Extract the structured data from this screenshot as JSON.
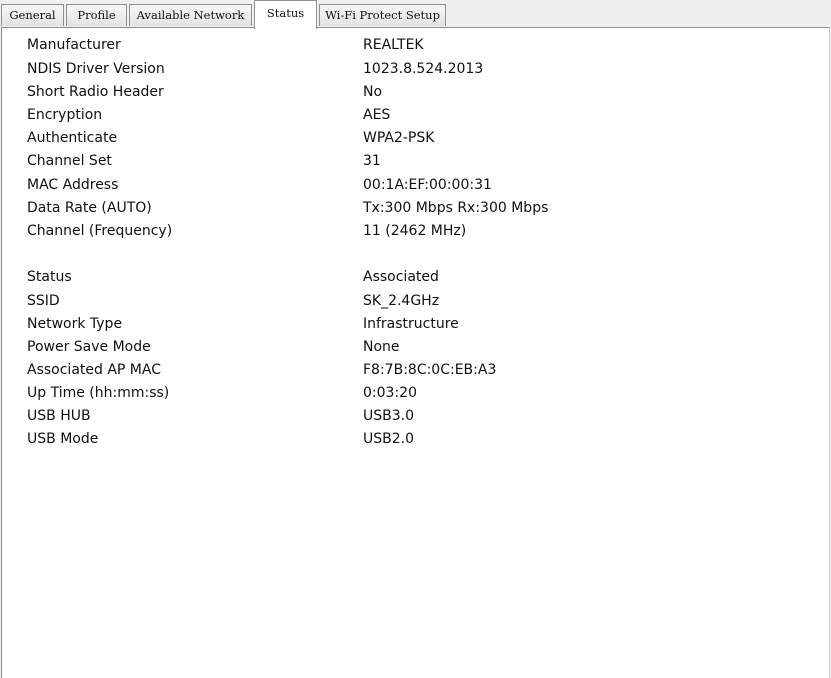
{
  "tabs": [
    {
      "label": "General"
    },
    {
      "label": "Profile"
    },
    {
      "label": "Available Network"
    },
    {
      "label": "Status",
      "active": true
    },
    {
      "label": "Wi-Fi Protect Setup"
    }
  ],
  "status_info": {
    "group1": [
      {
        "label": "Manufacturer",
        "value": "REALTEK"
      },
      {
        "label": "NDIS Driver Version",
        "value": "1023.8.524.2013"
      },
      {
        "label": "Short Radio Header",
        "value": "No"
      },
      {
        "label": "Encryption",
        "value": "AES"
      },
      {
        "label": "Authenticate",
        "value": "WPA2-PSK"
      },
      {
        "label": "Channel Set",
        "value": "31"
      },
      {
        "label": "MAC Address",
        "value": "00:1A:EF:00:00:31"
      },
      {
        "label": "Data Rate (AUTO)",
        "value": "Tx:300 Mbps Rx:300 Mbps"
      },
      {
        "label": "Channel (Frequency)",
        "value": "11 (2462 MHz)"
      }
    ],
    "group2": [
      {
        "label": "Status",
        "value": "Associated"
      },
      {
        "label": "SSID",
        "value": "SK_2.4GHz"
      },
      {
        "label": "Network Type",
        "value": "Infrastructure"
      },
      {
        "label": "Power Save Mode",
        "value": "None"
      },
      {
        "label": "Associated AP MAC",
        "value": "F8:7B:8C:0C:EB:A3"
      },
      {
        "label": "Up Time (hh:mm:ss)",
        "value": "0:03:20"
      },
      {
        "label": "USB HUB",
        "value": "USB3.0"
      },
      {
        "label": "USB Mode",
        "value": "USB2.0"
      }
    ]
  }
}
